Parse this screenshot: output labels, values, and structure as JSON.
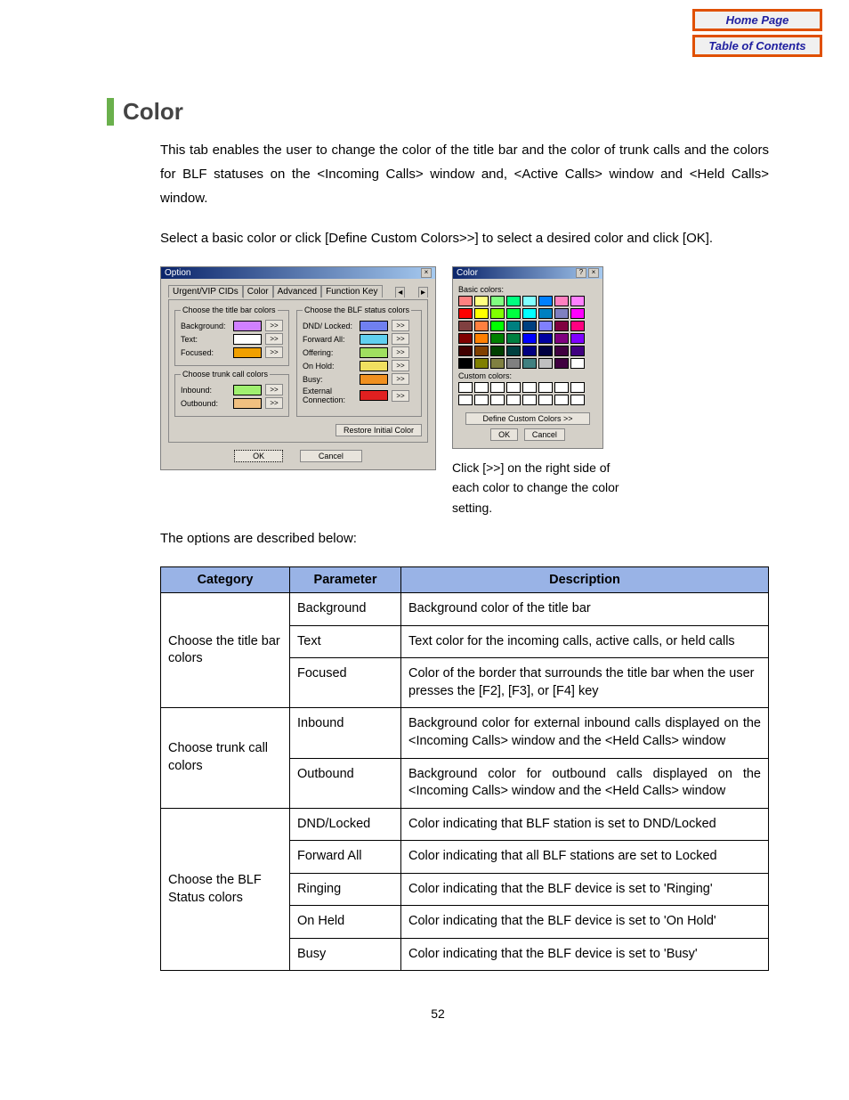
{
  "nav": {
    "home": "Home Page",
    "toc": "Table of Contents"
  },
  "heading": "Color",
  "para1": "This tab enables the user to change the color of the title bar and the color of trunk calls and the colors for BLF statuses on the <Incoming Calls> window and, <Active Calls> window and <Held Calls> window.",
  "para2": "Select a basic color or click [Define Custom Colors>>] to select a desired color and click [OK].",
  "option_dialog": {
    "title": "Option",
    "tabs": [
      "Urgent/VIP CIDs",
      "Color",
      "Advanced",
      "Function Key"
    ],
    "active_tab": 1,
    "group_title_bar": "Choose the title bar colors",
    "group_trunk": "Choose trunk call colors",
    "group_blf": "Choose the BLF status colors",
    "fields_title": [
      {
        "label": "Background:",
        "color": "#d080ff"
      },
      {
        "label": "Text:",
        "color": "#ffffff"
      },
      {
        "label": "Focused:",
        "color": "#f0a000"
      }
    ],
    "fields_trunk": [
      {
        "label": "Inbound:",
        "color": "#a0f070"
      },
      {
        "label": "Outbound:",
        "color": "#f0c080"
      }
    ],
    "fields_blf": [
      {
        "label": "DND/\nLocked:",
        "color": "#7080f0"
      },
      {
        "label": "Forward All:",
        "color": "#60d0f0"
      },
      {
        "label": "Offering:",
        "color": "#a0e060"
      },
      {
        "label": "On Hold:",
        "color": "#f0e060"
      },
      {
        "label": "Busy:",
        "color": "#f09020"
      },
      {
        "label": "External\nConnection:",
        "color": "#e02020"
      }
    ],
    "more_btn": ">>",
    "restore": "Restore Initial Color",
    "ok": "OK",
    "cancel": "Cancel"
  },
  "color_dialog": {
    "title": "Color",
    "basic_label": "Basic colors:",
    "basic": [
      "#ff8080",
      "#ffff80",
      "#80ff80",
      "#00ff80",
      "#80ffff",
      "#0080ff",
      "#ff80c0",
      "#ff80ff",
      "#ff0000",
      "#ffff00",
      "#80ff00",
      "#00ff40",
      "#00ffff",
      "#0080c0",
      "#8080c0",
      "#ff00ff",
      "#804040",
      "#ff8040",
      "#00ff00",
      "#008080",
      "#004080",
      "#8080ff",
      "#800040",
      "#ff0080",
      "#800000",
      "#ff8000",
      "#008000",
      "#008040",
      "#0000ff",
      "#0000a0",
      "#800080",
      "#8000ff",
      "#400000",
      "#804000",
      "#004000",
      "#004040",
      "#000080",
      "#000040",
      "#400040",
      "#400080",
      "#000000",
      "#808000",
      "#808040",
      "#808080",
      "#408080",
      "#c0c0c0",
      "#400040",
      "#ffffff"
    ],
    "custom_label": "Custom colors:",
    "custom_count": 16,
    "define": "Define Custom Colors >>",
    "ok": "OK",
    "cancel": "Cancel"
  },
  "side_note": "Click [>>] on the right side of each color to change the color setting.",
  "para3": "The options are described below:",
  "table": {
    "headers": [
      "Category",
      "Parameter",
      "Description"
    ],
    "rows": [
      {
        "cat": "Choose the title bar colors",
        "catspan": 3,
        "param": "Background",
        "desc": "Background color of the title bar"
      },
      {
        "param": "Text",
        "desc": "Text color for the incoming calls, active calls, or held calls"
      },
      {
        "param": "Focused",
        "desc": "Color of the border that surrounds the title bar when the user presses the [F2], [F3], or [F4] key"
      },
      {
        "cat": "Choose trunk call colors",
        "catspan": 2,
        "param": "Inbound",
        "desc": "Background color for external inbound calls displayed on the <Incoming Calls> window and the <Held Calls> window",
        "just": true
      },
      {
        "param": "Outbound",
        "desc": "Background color for outbound calls displayed on the <Incoming Calls> window and the <Held Calls> window",
        "just": true
      },
      {
        "cat": "Choose the BLF Status colors",
        "catspan": 5,
        "param": "DND/Locked",
        "desc": "Color indicating that BLF station is set to DND/Locked",
        "just": true
      },
      {
        "param": "Forward All",
        "desc": "Color indicating that all BLF stations are set to Locked",
        "just": true
      },
      {
        "param": "Ringing",
        "desc": "Color indicating that the BLF device is set to 'Ringing'",
        "just": true
      },
      {
        "param": "On Held",
        "desc": "Color indicating that the BLF device is set to 'On Hold'",
        "just": true
      },
      {
        "param": "Busy",
        "desc": "Color indicating that the BLF device is set to 'Busy'"
      }
    ]
  },
  "page_number": "52"
}
